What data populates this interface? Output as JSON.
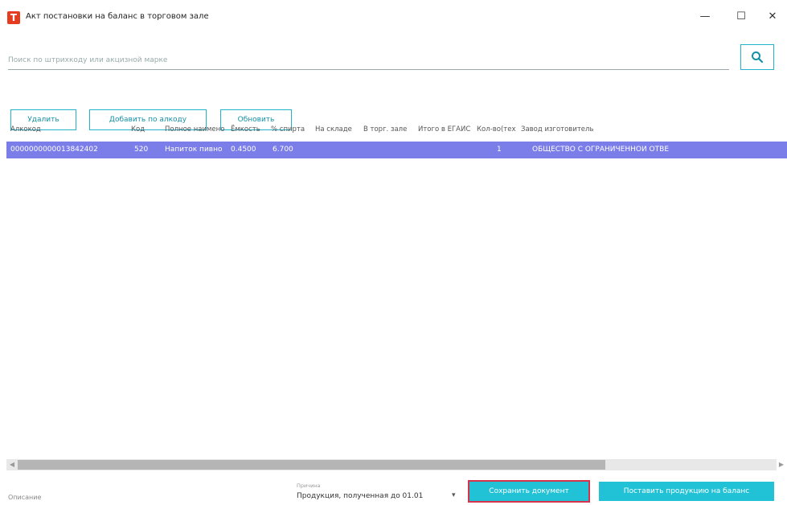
{
  "window": {
    "title": "Акт постановки на баланс в торговом зале",
    "logo_letter": "T",
    "minimize": "—",
    "maximize": "☐",
    "close": "✕"
  },
  "search": {
    "placeholder": "Поиск по штрихкоду или акцизной марке"
  },
  "toolbar": {
    "delete_label": "Удалить",
    "add_by_barcode_label": "Добавить по алкоду",
    "refresh_label": "Обновить"
  },
  "table": {
    "columns": [
      "Алкокод",
      "Код",
      "Полное наимено",
      "Ёмкость",
      "% спирта",
      "На складе",
      "В торг. зале",
      "Итого в ЕГАИС",
      "Кол-во(тех",
      "Завод изготовитель"
    ],
    "rows": [
      [
        "0000000000013842402",
        "520",
        "Напиток пивно",
        "0.4500",
        "6.700",
        "",
        "",
        "",
        "1",
        "ОБЩЕСТВО С ОГРАНИЧЕННОЙ ОТВЕ"
      ]
    ]
  },
  "footer": {
    "description_label": "Описание",
    "reason_caption": "Причина",
    "reason_value": "Продукция, полученная до 01.01",
    "save_label": "Сохранить документ",
    "post_label": "Поставить продукцию на баланс"
  },
  "colors": {
    "accent": "#21b3c8",
    "selected_row": "#7b7ee8",
    "save_outline": "#d6344d",
    "logo": "#e53c1f"
  }
}
